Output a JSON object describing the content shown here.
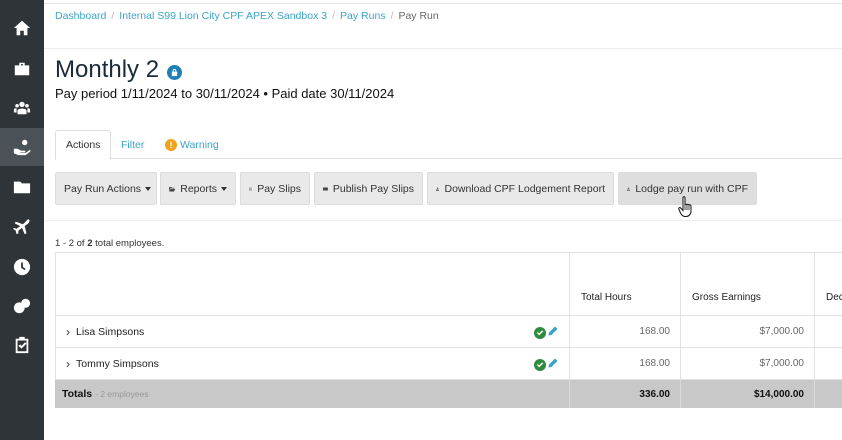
{
  "sidebar": {
    "items": [
      {
        "icon": "home-icon"
      },
      {
        "icon": "briefcase-icon"
      },
      {
        "icon": "people-icon"
      },
      {
        "icon": "hand-money-icon",
        "active": true
      },
      {
        "icon": "folder-icon"
      },
      {
        "icon": "plane-icon"
      },
      {
        "icon": "clock-icon"
      },
      {
        "icon": "coins-icon"
      },
      {
        "icon": "clipboard-check-icon"
      }
    ]
  },
  "breadcrumb": {
    "items": [
      "Dashboard",
      "Internal S99 Lion City CPF APEX Sandbox 3",
      "Pay Runs"
    ],
    "current": "Pay Run"
  },
  "page": {
    "title": "Monthly 2",
    "subtitle": "Pay period 1/11/2024 to 30/11/2024 • Paid date 30/11/2024"
  },
  "tabs": [
    {
      "label": "Actions",
      "active": true
    },
    {
      "label": "Filter"
    },
    {
      "label": "Warning",
      "badge": "!"
    }
  ],
  "toolbar": {
    "pay_run_actions": "Pay Run Actions",
    "reports": "Reports",
    "pay_slips": "Pay Slips",
    "publish_pay_slips": "Publish Pay Slips",
    "download_cpf": "Download CPF Lodgement Report",
    "lodge_cpf": "Lodge pay run with CPF"
  },
  "summary": {
    "range": "1 - 2 of",
    "total": "2",
    "suffix": "total employees."
  },
  "table": {
    "columns": [
      "",
      "Total Hours",
      "Gross Earnings",
      "Dec"
    ],
    "rows": [
      {
        "name": "Lisa Simpsons",
        "hours": "168.00",
        "gross": "$7,000.00"
      },
      {
        "name": "Tommy Simpsons",
        "hours": "168.00",
        "gross": "$7,000.00"
      }
    ],
    "totals": {
      "label": "Totals",
      "sub": "- 2 employees",
      "hours": "336.00",
      "gross": "$14,000.00"
    }
  },
  "colors": {
    "sidebar": "#2e3438",
    "link": "#3ba4c7",
    "warning": "#f0a31b",
    "success": "#2e8b3f",
    "lock": "#1f7fb5"
  }
}
